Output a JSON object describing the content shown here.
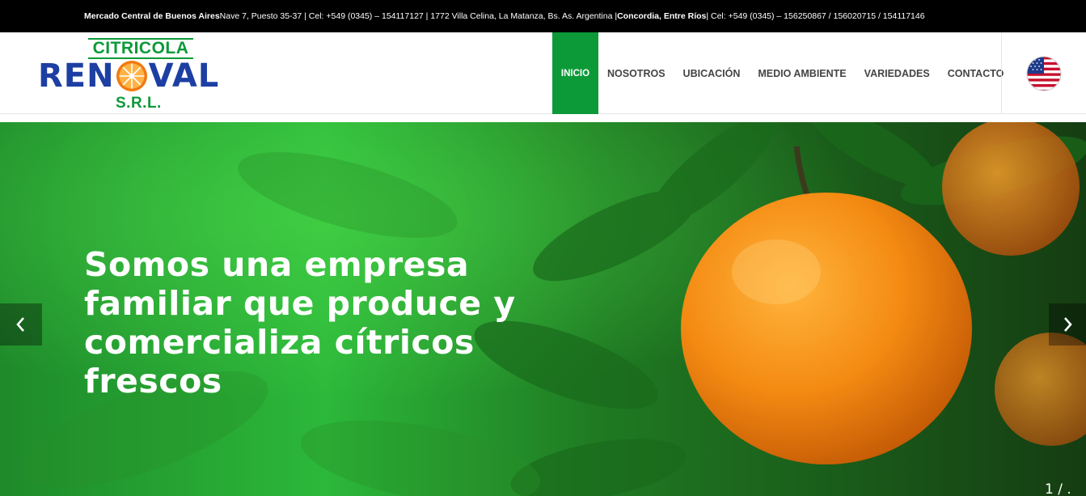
{
  "topbar": {
    "loc1_name": "Mercado Central de Buenos Aires",
    "loc1_detail": " Nave 7, Puesto 35-37 | Cel: +549 (0345) – 154117127 | 1772 Villa Celina, La Matanza, Bs. As. Argentina | ",
    "loc2_name": "Concordia, Entre Ríos",
    "loc2_detail": " | Cel: +549 (0345) – 156250867 / 156020715 / 154117146"
  },
  "logo": {
    "top": "CITRICOLA",
    "main_left": "REN",
    "main_right": "VAL",
    "bottom": "S.R.L."
  },
  "nav": {
    "items": [
      {
        "label": "INICIO",
        "active": true
      },
      {
        "label": "NOSOTROS",
        "active": false
      },
      {
        "label": "UBICACIÓN",
        "active": false
      },
      {
        "label": "MEDIO AMBIENTE",
        "active": false
      },
      {
        "label": "VARIEDADES",
        "active": false
      },
      {
        "label": "CONTACTO",
        "active": false
      }
    ]
  },
  "language": {
    "icon": "us-flag-icon"
  },
  "hero": {
    "headline": "Somos una empresa familiar que produce y comercializa cítricos frescos",
    "counter": "1 / ."
  },
  "colors": {
    "brand_green": "#0c9a38",
    "brand_blue": "#1d3fa3",
    "orange": "#f07a10"
  }
}
